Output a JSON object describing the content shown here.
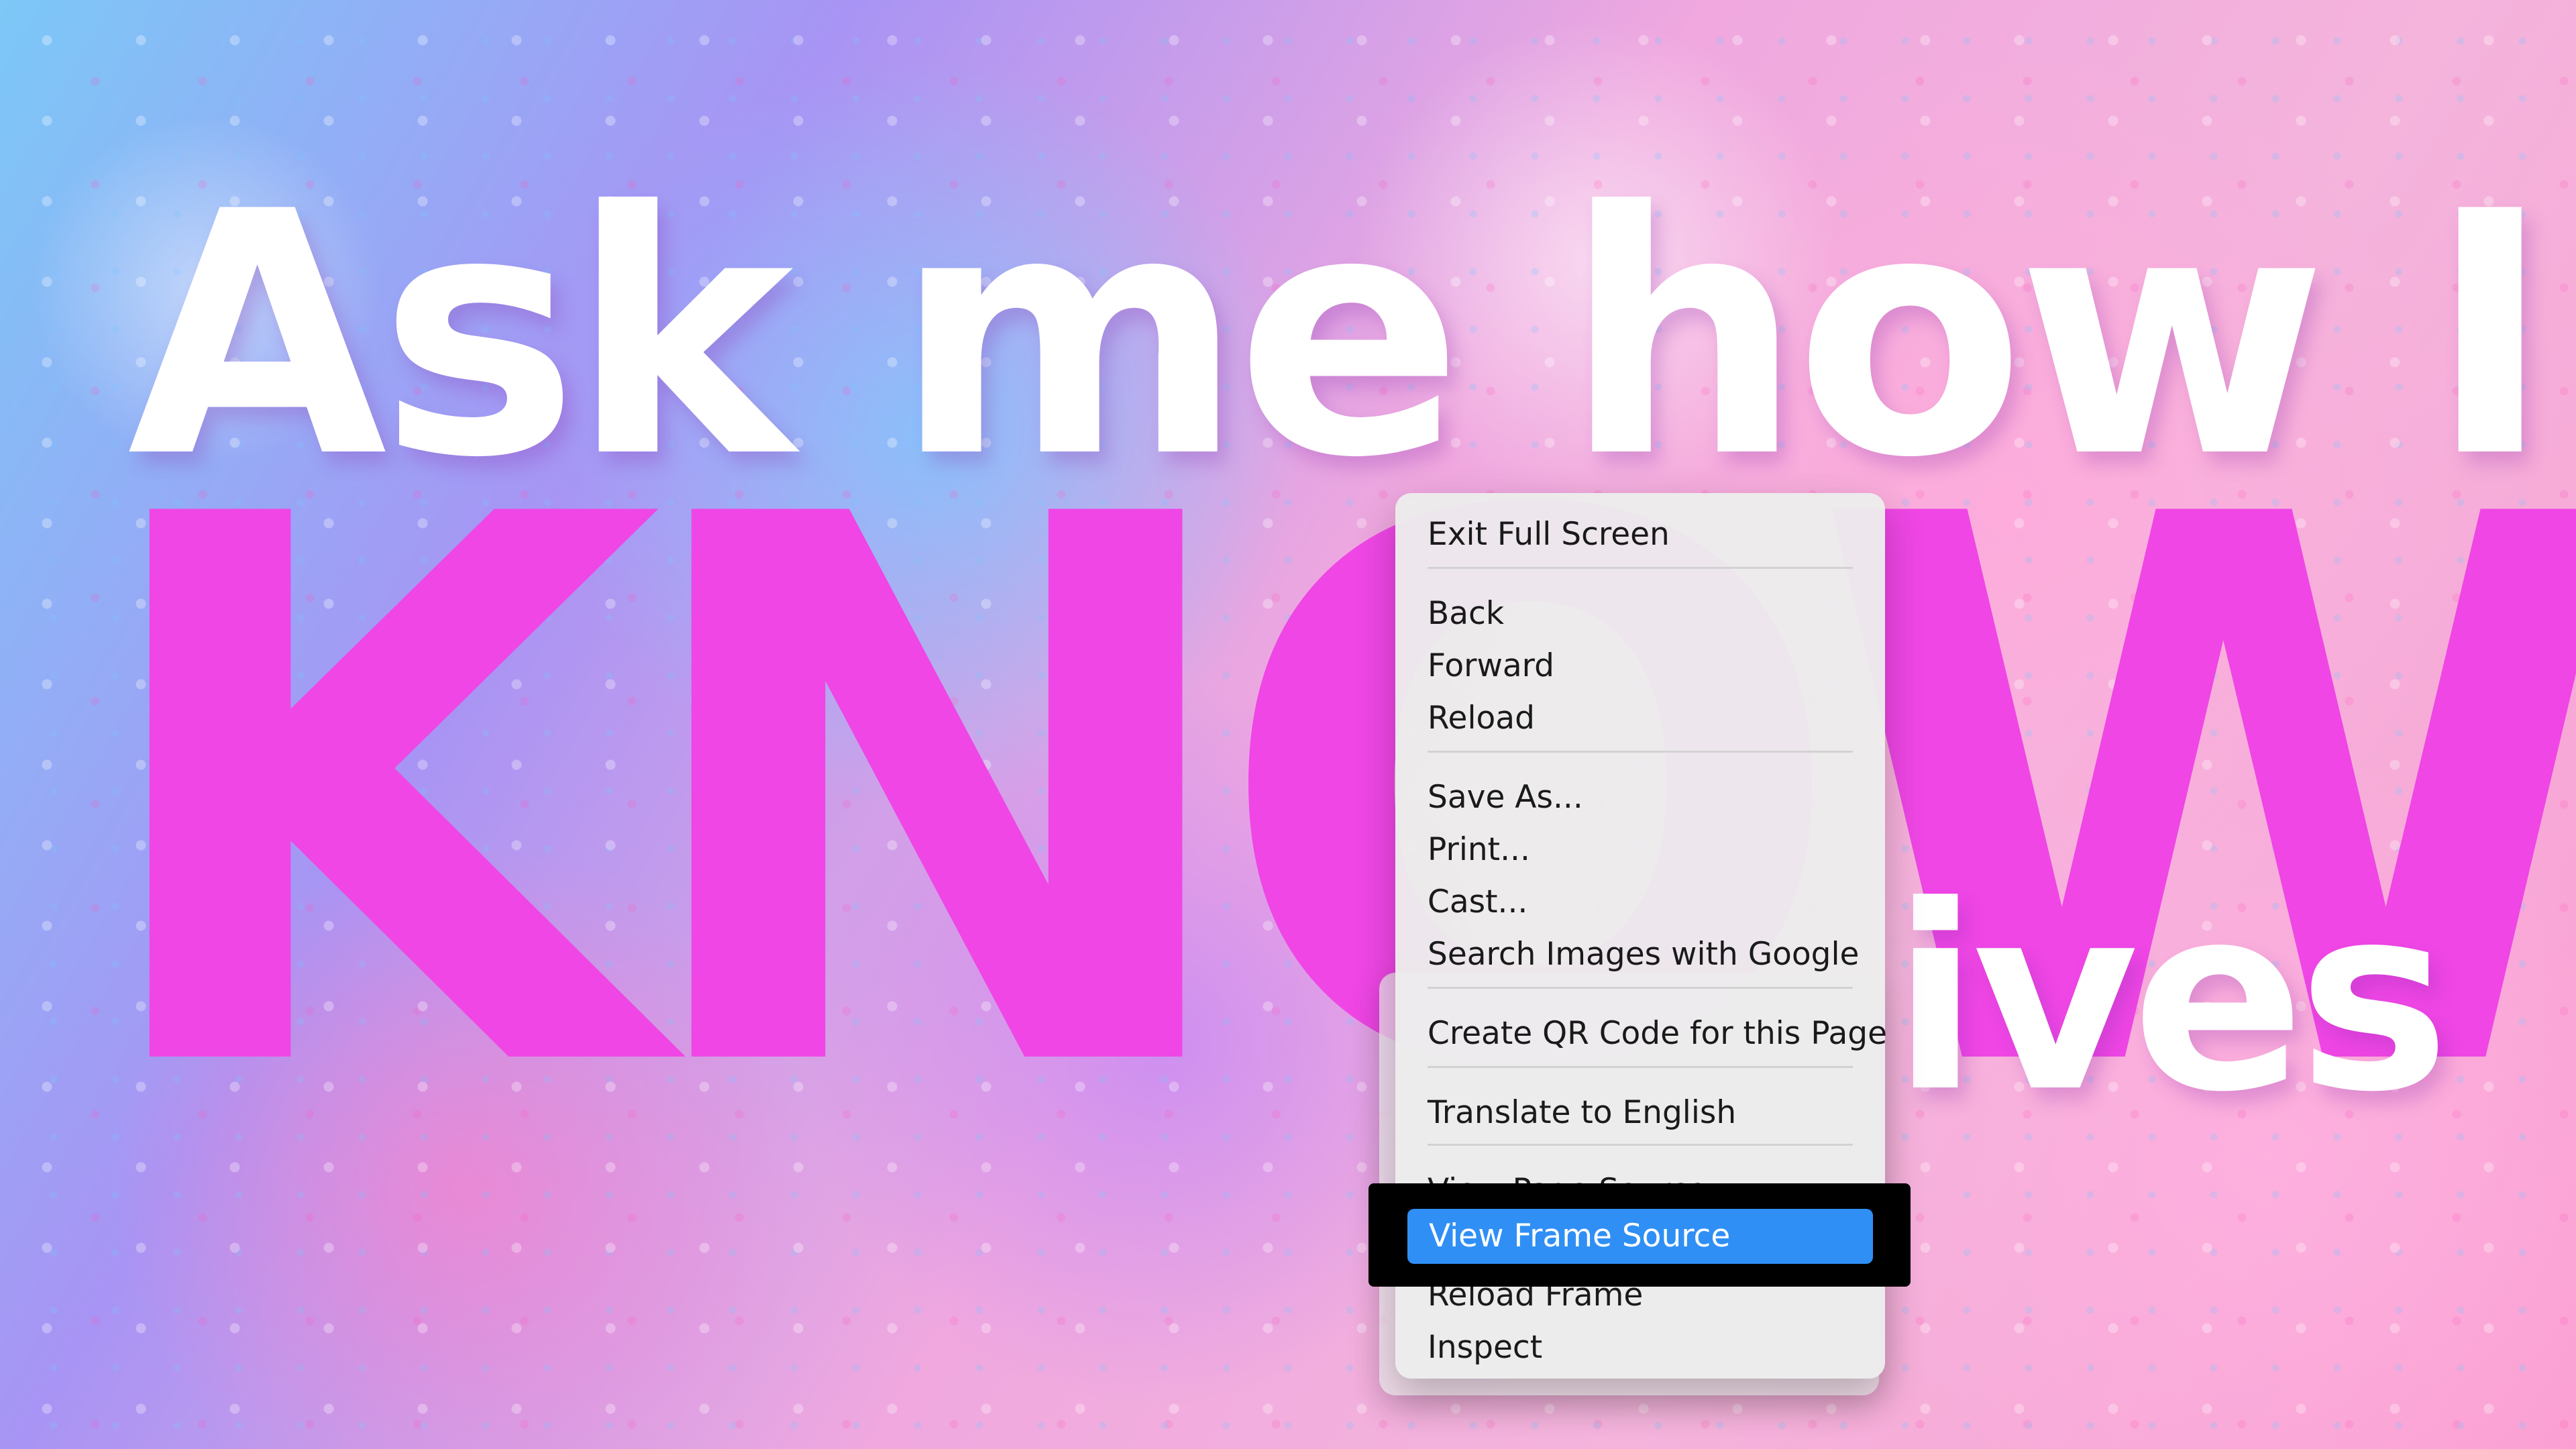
{
  "background": {
    "headline": "Ask me how I",
    "big_word": "KNOW",
    "side_word": "ives"
  },
  "context_menu": {
    "items": [
      "Exit Full Screen",
      "Back",
      "Forward",
      "Reload",
      "Save As...",
      "Print...",
      "Cast...",
      "Search Images with Google",
      "Create QR Code for this Page",
      "Translate to English",
      "View Page Source",
      "View Frame Source",
      "Reload Frame",
      "Inspect"
    ]
  },
  "colors": {
    "menu_background": "#ececec",
    "menu_text": "#1a1a1a",
    "highlight": "#2f8ff5",
    "highlight_text": "#ffffff",
    "big_word": "#ef46e5",
    "headline": "#ffffff",
    "focus_outline": "#000000"
  }
}
